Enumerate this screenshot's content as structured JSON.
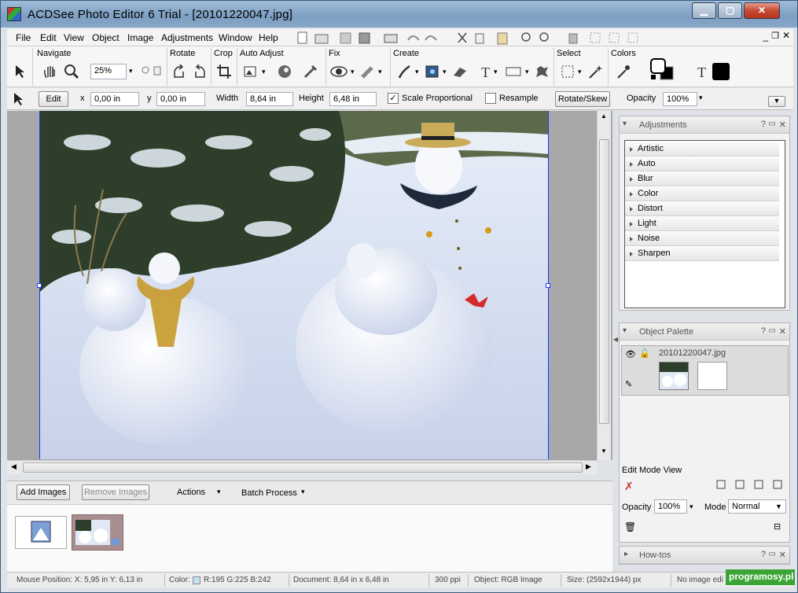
{
  "window": {
    "title": "ACDSee Photo Editor 6 Trial - [20101220047.jpg]"
  },
  "menu": [
    "File",
    "Edit",
    "View",
    "Object",
    "Image",
    "Adjustments",
    "Window",
    "Help"
  ],
  "toolbar": {
    "groups": {
      "navigate": "Navigate",
      "rotate": "Rotate",
      "crop": "Crop",
      "auto_adjust": "Auto Adjust",
      "fix": "Fix",
      "create": "Create",
      "select": "Select",
      "colors": "Colors"
    },
    "zoom": "25%"
  },
  "options": {
    "edit_label": "Edit",
    "x_label": "x",
    "x_value": "0,00 in",
    "y_label": "y",
    "y_value": "0,00 in",
    "width_label": "Width",
    "width_value": "8,64 in",
    "height_label": "Height",
    "height_value": "6,48 in",
    "scale_label": "Scale Proportional",
    "resample_label": "Resample",
    "rotate_label": "Rotate/Skew",
    "opacity_label": "Opacity",
    "opacity_value": "100%"
  },
  "filmbar": {
    "add": "Add Images",
    "remove": "Remove Images",
    "actions": "Actions",
    "batch": "Batch Process"
  },
  "adjustments": {
    "title": "Adjustments",
    "items": [
      "Artistic",
      "Auto",
      "Blur",
      "Color",
      "Distort",
      "Light",
      "Noise",
      "Sharpen"
    ]
  },
  "object_palette": {
    "title": "Object Palette",
    "file": "20101220047.jpg"
  },
  "edit_mode": {
    "title": "Edit Mode View",
    "opacity_label": "Opacity",
    "opacity_value": "100%",
    "mode_label": "Mode",
    "mode_value": "Normal"
  },
  "howtos": {
    "title": "How-tos"
  },
  "status": {
    "mouse": "Mouse Position: X: 5,95 in   Y: 6,13 in",
    "color": "Color:",
    "rgb": "R:195  G:225  B:242",
    "document": "Document: 8,64 in x 6,48 in",
    "ppi": "300 ppi",
    "object": "Object: RGB Image",
    "size": "Size: (2592x1944) px",
    "noedit": "No image edi",
    "watermark": "programosy.pl"
  },
  "colors": {
    "pixel": "#c3e1f2"
  }
}
